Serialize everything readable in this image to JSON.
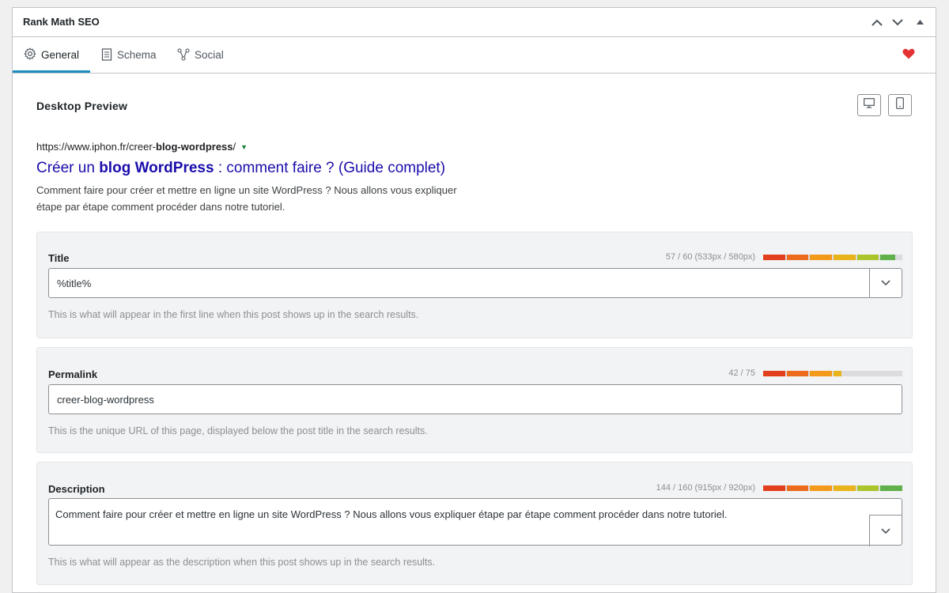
{
  "panel": {
    "title": "Rank Math SEO"
  },
  "header_controls": [
    "chevron-up-icon",
    "chevron-down-icon",
    "triangle-up-icon"
  ],
  "tabs": [
    {
      "label": "General",
      "icon": "gear-icon",
      "active": true
    },
    {
      "label": "Schema",
      "icon": "document-icon",
      "active": false
    },
    {
      "label": "Social",
      "icon": "share-icon",
      "active": false
    }
  ],
  "favorite_icon": "heart-icon",
  "preview": {
    "heading": "Desktop Preview",
    "device_buttons": [
      "desktop-icon",
      "mobile-icon"
    ],
    "url_prefix": "https://www.iphon.fr/creer-",
    "url_bold": "blog-wordpress",
    "url_suffix": "/",
    "title_part1": "Créer un ",
    "title_bold": "blog WordPress",
    "title_part2": " : comment faire ? (Guide complet)",
    "desc_line1": "Comment faire pour créer et mettre en ligne un site WordPress ? Nous allons vous expliquer",
    "desc_line2": "étape par étape comment procéder dans notre tutoriel."
  },
  "fields": {
    "title": {
      "label": "Title",
      "count": "57 / 60 (533px / 580px)",
      "value": "%title%",
      "help": "This is what will appear in the first line when this post shows up in the search results.",
      "fill_fraction": 0.95
    },
    "permalink": {
      "label": "Permalink",
      "count": "42 / 75",
      "value": "creer-blog-wordpress",
      "help": "This is the unique URL of this page, displayed below the post title in the search results.",
      "fill_fraction": 0.56
    },
    "description": {
      "label": "Description",
      "count": "144 / 160 (915px / 920px)",
      "value": "Comment faire pour créer et mettre en ligne un site WordPress ? Nous allons vous expliquer étape par étape comment procéder dans notre tutoriel.",
      "help": "This is what will appear as the description when this post shows up in the search results.",
      "fill_fraction": 1.0
    }
  },
  "colors": {
    "link": "#1a0dab",
    "tab_active": "#1e8cbe",
    "heart": "#e33333",
    "bar_segments": [
      "#e2401c",
      "#ec6b1d",
      "#f49a1b",
      "#e8b31b",
      "#a8c52b",
      "#60b04b"
    ]
  }
}
